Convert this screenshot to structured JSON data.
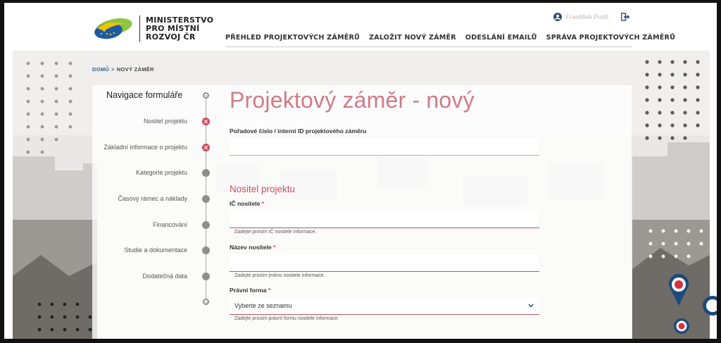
{
  "logo": {
    "line1": "MINISTERSTVO",
    "line2": "PRO MÍSTNÍ",
    "line3": "ROZVOJ ČR"
  },
  "user": {
    "name": "František Purkl",
    "icon": "user-icon",
    "logout_icon": "logout-icon"
  },
  "nav": {
    "items": [
      "PŘEHLED PROJEKTOVÝCH ZÁMĚRŮ",
      "ZALOŽIT NOVÝ ZÁMĚR",
      "ODESLÁNÍ EMAILŮ",
      "SPRÁVA PROJEKTOVÝCH ZÁMĚRŮ"
    ]
  },
  "breadcrumb": {
    "home": "DOMŮ",
    "separator": ">",
    "current": "NOVÝ ZÁMĚR"
  },
  "form_nav": {
    "title": "Navigace formuláře",
    "items": [
      {
        "label": "Nositel projektu",
        "state": "error"
      },
      {
        "label": "Základní informace o projektu",
        "state": "error"
      },
      {
        "label": "Kategorie projektu",
        "state": "neutral"
      },
      {
        "label": "Časový rámec a náklady",
        "state": "neutral"
      },
      {
        "label": "Financování",
        "state": "neutral"
      },
      {
        "label": "Studie a dokumentace",
        "state": "neutral"
      },
      {
        "label": "Dodatečná data",
        "state": "neutral"
      }
    ]
  },
  "form": {
    "title": "Projektový záměr - nový",
    "order_label": "Pořadové číslo / interní ID projektového záměru",
    "order_value": "",
    "section_title": "Nositel projektu",
    "ic_label": "IČ nositele",
    "ic_value": "",
    "ic_help": "Zadejte prosím IČ nositele informace.",
    "name_label": "Název nositele",
    "name_value": "",
    "name_help": "Zadejte prosím jméno nositele informace.",
    "legal_label": "Právní forma",
    "legal_selected": "Vyberte ze seznamu",
    "legal_help": "Zadejte prosím právní formu nositele informace.",
    "required_mark": "*"
  },
  "colors": {
    "accent": "#c8505e",
    "title_pink": "#d27a86",
    "link_blue": "#2f5f88",
    "error_marker": "#d14a5a",
    "neutral_marker": "#8e8e8e"
  }
}
